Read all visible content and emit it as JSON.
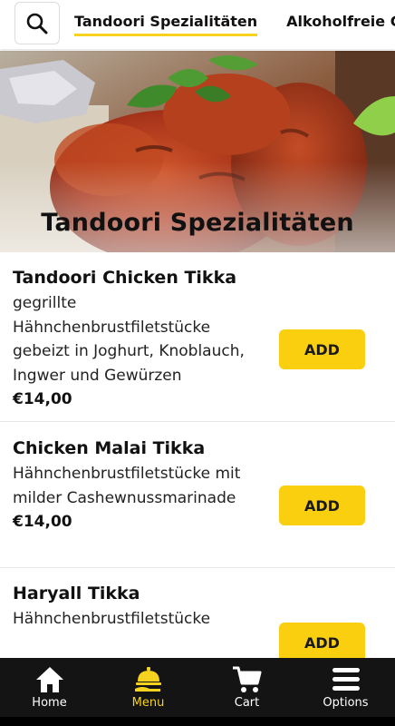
{
  "header": {
    "search_icon": "search-icon",
    "tabs": [
      {
        "label": "Tandoori Spezialitäten",
        "active": true
      },
      {
        "label": "Alkoholfreie Getränke",
        "active": false
      }
    ]
  },
  "hero": {
    "title": "Tandoori Spezialitäten"
  },
  "items": [
    {
      "name": "Tandoori Chicken Tikka",
      "description": "gegrillte Hähnchenbrustfiletstücke gebeizt in Joghurt, Knoblauch, Ingwer und Gewürzen",
      "price": "€14,00",
      "add_label": "ADD"
    },
    {
      "name": "Chicken Malai Tikka",
      "description": "Hähnchenbrustfiletstücke mit milder Cashewnussmarinade",
      "price": "€14,00",
      "add_label": "ADD"
    },
    {
      "name": "Haryall Tikka",
      "description": "Hähnchenbrustfiletstücke",
      "price": "",
      "add_label": "ADD"
    }
  ],
  "bottom_nav": [
    {
      "label": "Home",
      "icon": "home-icon"
    },
    {
      "label": "Menu",
      "icon": "waiter-cloche-icon",
      "active": true
    },
    {
      "label": "Cart",
      "icon": "cart-icon"
    },
    {
      "label": "Options",
      "icon": "hamburger-menu-icon"
    }
  ],
  "colors": {
    "accent": "#f9cf10",
    "nav_bg": "#141414",
    "active_nav": "#f7d21e"
  }
}
